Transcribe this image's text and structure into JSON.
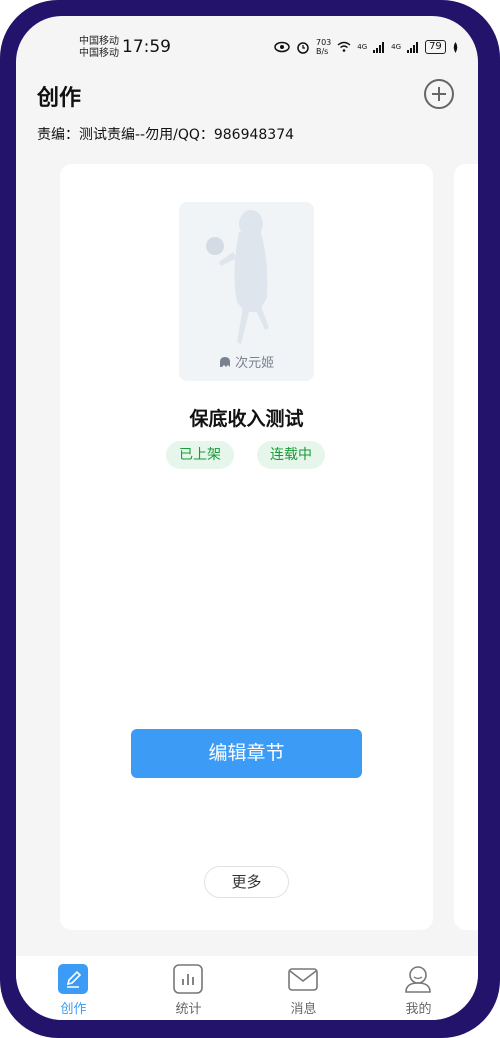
{
  "status_bar": {
    "carrier1": "中国移动",
    "carrier2": "中国移动",
    "time": "17:59",
    "speed": "703\nB/s",
    "network1": "4G",
    "network2": "4G",
    "battery": "79"
  },
  "header": {
    "title": "创作",
    "editor_line": "责编：测试责编--勿用/QQ：986948374"
  },
  "book": {
    "cover_logo": "次元姬",
    "title": "保底收入测试",
    "tags": [
      "已上架",
      "连载中"
    ],
    "edit_button": "编辑章节",
    "more_button": "更多"
  },
  "tabs": [
    {
      "label": "创作",
      "icon": "edit-icon",
      "active": true
    },
    {
      "label": "统计",
      "icon": "chart-icon",
      "active": false
    },
    {
      "label": "消息",
      "icon": "mail-icon",
      "active": false
    },
    {
      "label": "我的",
      "icon": "user-icon",
      "active": false
    }
  ],
  "colors": {
    "accent": "#3b9bf5",
    "tag_bg": "#e6f6ea",
    "tag_text": "#1a9a3a",
    "frame": "#24136a"
  }
}
